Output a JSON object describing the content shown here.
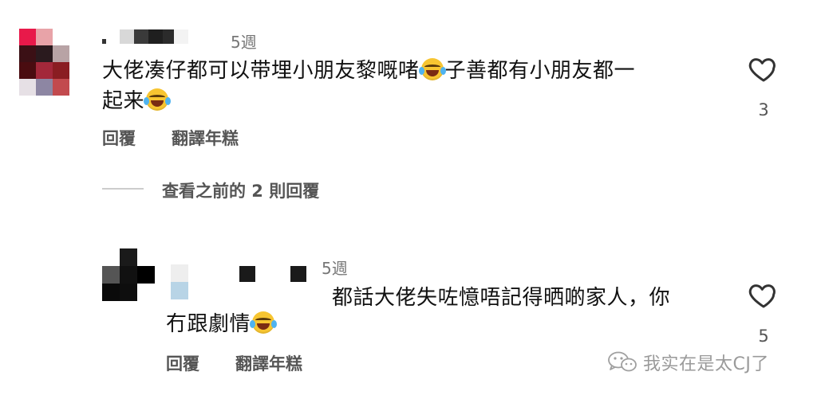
{
  "comment1": {
    "time": "5週",
    "text_line1": "大佬凑仔都可以带埋小朋友黎嘅啫",
    "text_line1b": "子善都有小朋友都一",
    "text_line2": "起来",
    "reply": "回覆",
    "translate": "翻譯年糕",
    "likes": "3"
  },
  "view_replies": "查看之前的 2 則回覆",
  "comment2": {
    "time": "5週",
    "text_line1": "都話大佬失咗憶唔記得晒啲家人，你",
    "text_line2": "冇跟劇情",
    "reply": "回覆",
    "translate": "翻譯年糕",
    "likes": "5"
  },
  "watermark": "我实在是太CJ了",
  "icons": {
    "heart": "heart-icon",
    "wechat": "wechat-icon",
    "emoji": "face-with-tears-of-joy-icon"
  },
  "colors": {
    "text": "#111111",
    "muted": "#555555",
    "time": "#777777"
  }
}
